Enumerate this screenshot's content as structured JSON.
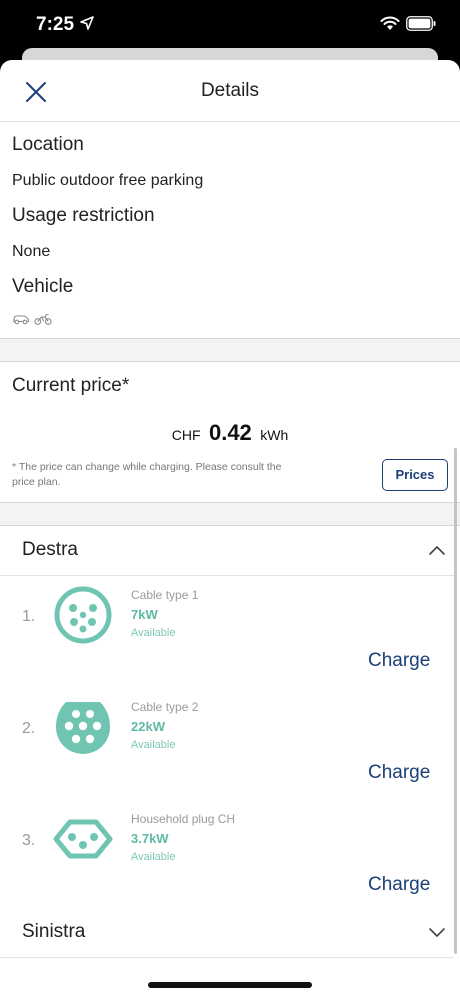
{
  "status_bar": {
    "time": "7:25"
  },
  "header": {
    "title": "Details"
  },
  "info": {
    "location_label": "Location",
    "location_value": "Public outdoor free parking",
    "restriction_label": "Usage restriction",
    "restriction_value": "None",
    "vehicle_label": "Vehicle",
    "vehicle_icons": [
      "car-icon",
      "motorbike-icon"
    ]
  },
  "price": {
    "heading": "Current price*",
    "currency": "CHF",
    "amount": "0.42",
    "unit": "kWh",
    "note": "* The price can change while charging. Please consult the price plan.",
    "button_label": "Prices"
  },
  "sections": {
    "destra": {
      "title": "Destra",
      "expanded": true,
      "connectors": [
        {
          "index": "1.",
          "type": "Cable type 1",
          "power": "7kW",
          "status": "Available",
          "charge_label": "Charge",
          "icon": "type1-plug-icon"
        },
        {
          "index": "2.",
          "type": "Cable type 2",
          "power": "22kW",
          "status": "Available",
          "charge_label": "Charge",
          "icon": "type2-plug-icon"
        },
        {
          "index": "3.",
          "type": "Household plug CH",
          "power": "3.7kW",
          "status": "Available",
          "charge_label": "Charge",
          "icon": "household-plug-icon"
        }
      ]
    },
    "sinistra": {
      "title": "Sinistra",
      "expanded": false
    }
  },
  "colors": {
    "accent": "#1b3f78",
    "connector": "#6fc5b2",
    "text": "#222222",
    "muted": "#9a9a9a"
  }
}
